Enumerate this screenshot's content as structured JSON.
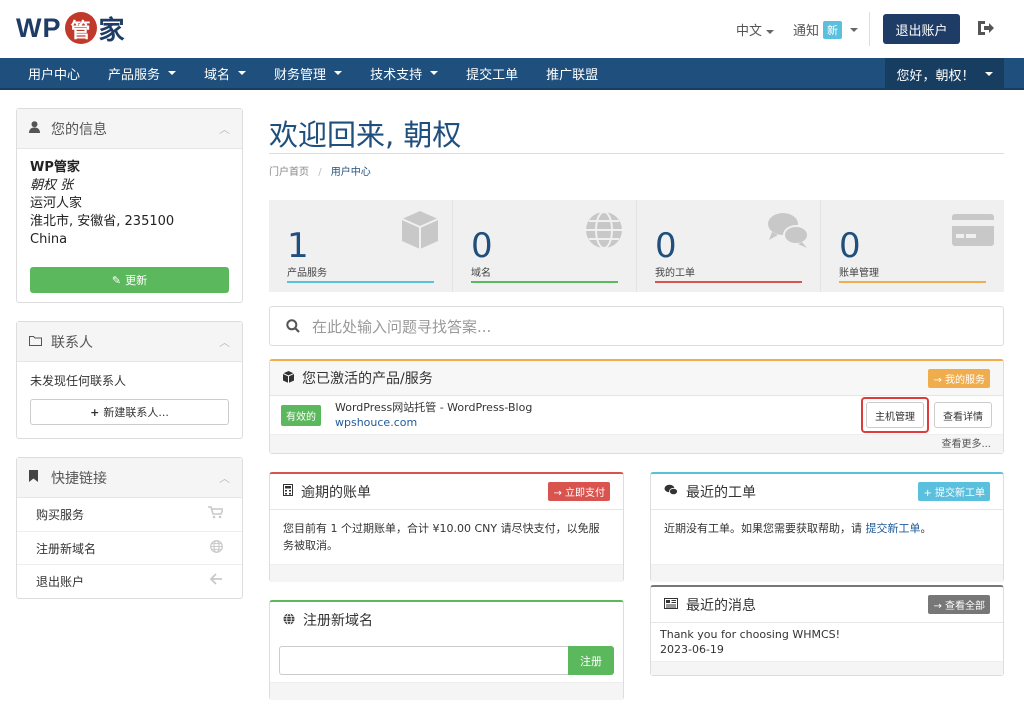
{
  "header": {
    "logo_prefix": "WP",
    "logo_seal": "管",
    "logo_suffix": "家",
    "language": "中文",
    "notify_label": "通知",
    "notify_badge": "新",
    "logout_label": "退出账户"
  },
  "nav": {
    "items": [
      {
        "label": "用户中心",
        "dropdown": false
      },
      {
        "label": "产品服务",
        "dropdown": true
      },
      {
        "label": "域名",
        "dropdown": true
      },
      {
        "label": "财务管理",
        "dropdown": true
      },
      {
        "label": "技术支持",
        "dropdown": true
      },
      {
        "label": "提交工单",
        "dropdown": false
      },
      {
        "label": "推广联盟",
        "dropdown": false
      }
    ],
    "greeting": "您好，朝权！"
  },
  "sidebar": {
    "info": {
      "title": "您的信息",
      "lines": [
        "WP管家",
        "朝权 张",
        "运河人家",
        "淮北市, 安徽省, 235100",
        "China"
      ],
      "update_label": "更新"
    },
    "contacts": {
      "title": "联系人",
      "empty": "未发现任何联系人",
      "new_label": "新建联系人..."
    },
    "links": {
      "title": "快捷链接",
      "items": [
        {
          "label": "购买服务",
          "icon": "cart-icon"
        },
        {
          "label": "注册新域名",
          "icon": "globe-icon"
        },
        {
          "label": "退出账户",
          "icon": "arrow-left-icon"
        }
      ]
    }
  },
  "main": {
    "title": "欢迎回来, 朝权",
    "breadcrumb": {
      "home": "门户首页",
      "sep": "/",
      "current": "用户中心"
    },
    "tiles": [
      {
        "value": "1",
        "label": "产品服务",
        "color": "#5bc0de",
        "icon": "box-icon"
      },
      {
        "value": "0",
        "label": "域名",
        "color": "#5cb85c",
        "icon": "globe-icon"
      },
      {
        "value": "0",
        "label": "我的工单",
        "color": "#d9534f",
        "icon": "comments-icon"
      },
      {
        "value": "0",
        "label": "账单管理",
        "color": "#f0ad4e",
        "icon": "credit-card-icon"
      }
    ],
    "search_placeholder": "在此处输入问题寻找答案...",
    "services": {
      "title": "您已激活的产品/服务",
      "badge": "→ 我的服务",
      "status": "有效的",
      "name": "WordPress网站托管 - WordPress-Blog",
      "domain": "wpshouce.com",
      "manage_label": "主机管理",
      "detail_label": "查看详情",
      "more_label": "查看更多..."
    },
    "invoices": {
      "title": "逾期的账单",
      "badge": "→ 立即支付",
      "text": "您目前有 1 个过期账单，合计 ¥10.00 CNY 请尽快支付，以免服务被取消。"
    },
    "tickets": {
      "title": "最近的工单",
      "badge": "+ 提交新工单",
      "text": "近期没有工单。如果您需要获取帮助，请",
      "link": "提交新工单",
      "end": "。"
    },
    "domain_reg": {
      "title": "注册新域名",
      "input_placeholder": "",
      "button": "注册"
    },
    "news": {
      "title": "最近的消息",
      "badge": "→ 查看全部",
      "item_text": "Thank you for choosing WHMCS!",
      "item_date": "2023-06-19"
    }
  },
  "colors": {
    "brand": "#1f4f7c",
    "green": "#5cb85c",
    "red": "#d9534f",
    "orange": "#f0ad4e",
    "blue": "#5bc0de",
    "gray": "#777777"
  }
}
